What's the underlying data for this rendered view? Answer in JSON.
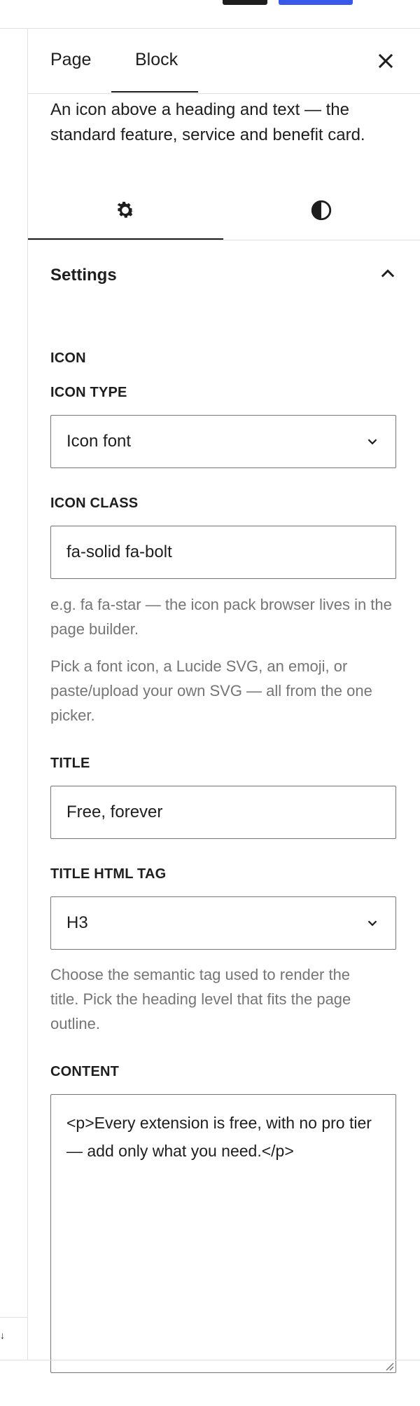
{
  "sidebar": {
    "tabs": [
      {
        "label": "Page"
      },
      {
        "label": "Block"
      }
    ],
    "description": "An icon above a heading and text — the standard feature, service and benefit card."
  },
  "panel": {
    "title": "Settings",
    "section_label": "ICON",
    "icon_type": {
      "label": "ICON TYPE",
      "value": "Icon font"
    },
    "icon_class": {
      "label": "ICON CLASS",
      "value": "fa-solid fa-bolt"
    },
    "icon_help_1": "e.g. fa fa-star — the icon pack browser lives in the page builder.",
    "icon_help_2": "Pick a font icon, a Lucide SVG, an emoji, or paste/upload your own SVG — all from the one picker.",
    "title_field": {
      "label": "TITLE",
      "value": "Free, forever"
    },
    "title_tag": {
      "label": "TITLE HTML TAG",
      "value": "H3"
    },
    "title_tag_help": "Choose the semantic tag used to render the title. Pick the heading level that fits the page outline.",
    "content": {
      "label": "CONTENT",
      "value": "<p>Every extension is free, with no pro tier — add only what you need.</p>"
    }
  }
}
